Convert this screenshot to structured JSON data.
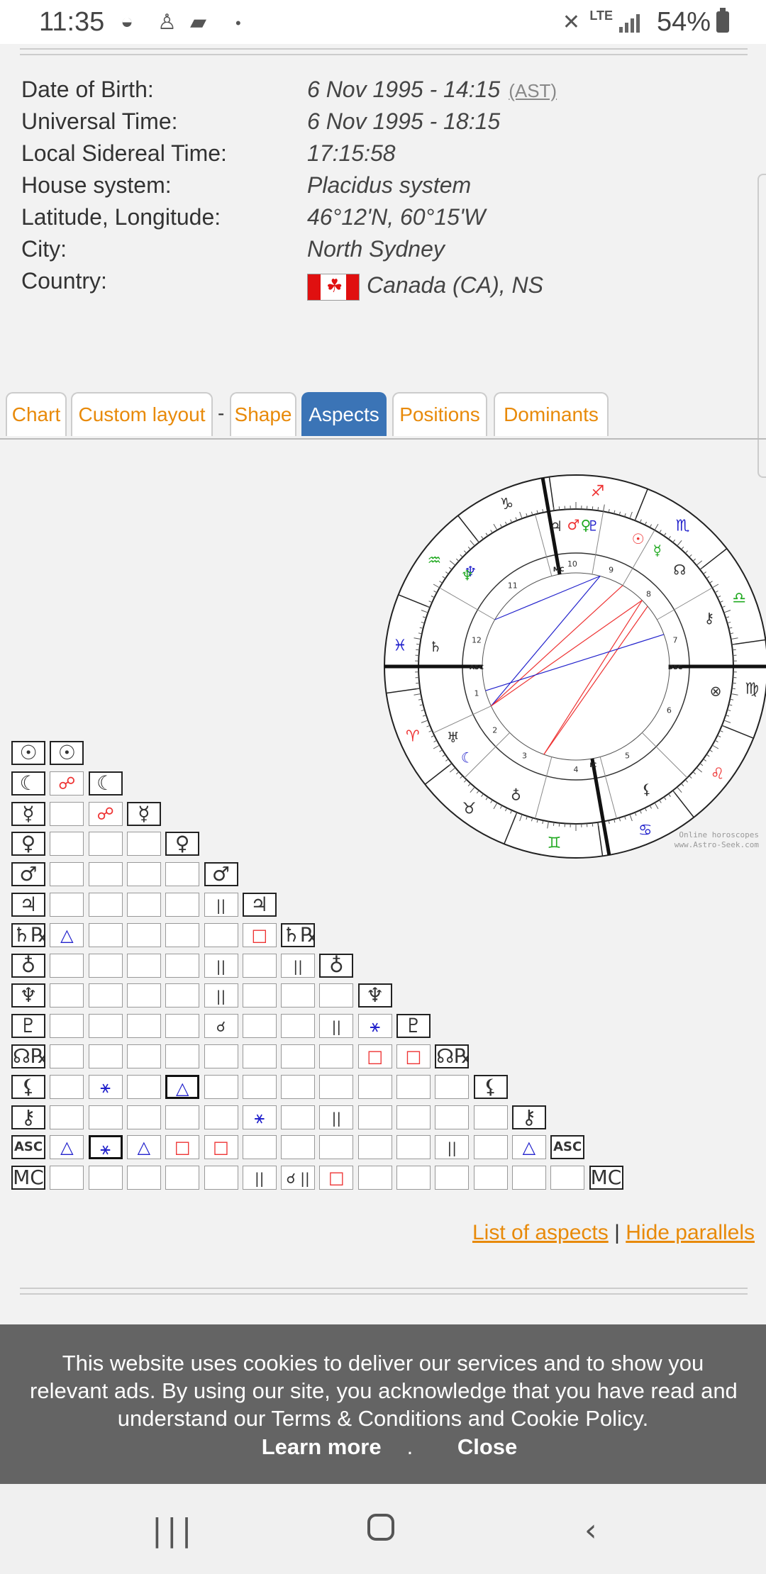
{
  "status_bar": {
    "time": "11:35",
    "network": "LTE",
    "battery": "54%"
  },
  "birth_info": [
    {
      "label": "Date of Birth:",
      "value": "6 Nov 1995 - 14:15",
      "extra": "(AST)"
    },
    {
      "label": "Universal Time:",
      "value": "6 Nov 1995 - 18:15"
    },
    {
      "label": "Local Sidereal Time:",
      "value": "17:15:58"
    },
    {
      "label": "House system:",
      "value": "Placidus system"
    },
    {
      "label": "Latitude, Longitude:",
      "value": "46°12'N, 60°15'W"
    },
    {
      "label": "City:",
      "value": "North Sydney"
    },
    {
      "label": "Country:",
      "value": "Canada (CA), NS"
    }
  ],
  "tabs": [
    "Chart",
    "Custom layout",
    "Shape",
    "Aspects",
    "Positions",
    "Dominants"
  ],
  "tab_separator": "-",
  "active_tab": "Aspects",
  "wheel": {
    "angles": [
      "MC",
      "IC",
      "ASC",
      "DSC"
    ],
    "houses": [
      "1",
      "2",
      "3",
      "4",
      "5",
      "6",
      "7",
      "8",
      "9",
      "10",
      "11",
      "12"
    ],
    "signs": [
      "♑",
      "♐",
      "♏",
      "♎",
      "♍",
      "♌",
      "♋",
      "♊",
      "♉",
      "♈",
      "♓",
      "♒"
    ],
    "watermark_line1": "Online horoscopes",
    "watermark_line2": "www.Astro-Seek.com"
  },
  "aspect_grid": {
    "planets": [
      "☉",
      "☾",
      "☿",
      "♀",
      "♂",
      "♃",
      "♄℞",
      "♁",
      "♆",
      "♇",
      "☊℞",
      "⚸",
      "⚷",
      "ASC",
      "MC"
    ],
    "cells": [
      {
        "r": 1,
        "c": 0,
        "sym": "☍",
        "color": "red"
      },
      {
        "r": 2,
        "c": 1,
        "sym": "☍",
        "color": "red"
      },
      {
        "r": 5,
        "c": 4,
        "sym": "||",
        "color": "black"
      },
      {
        "r": 5,
        "c": 5,
        "sym": "☌ ||",
        "color": "black"
      },
      {
        "r": 6,
        "c": 0,
        "sym": "△",
        "color": "blue"
      },
      {
        "r": 6,
        "c": 5,
        "sym": "□",
        "color": "red"
      },
      {
        "r": 6,
        "c": 6,
        "sym": "□",
        "color": "red"
      },
      {
        "r": 7,
        "c": 4,
        "sym": "||",
        "color": "black"
      },
      {
        "r": 7,
        "c": 6,
        "sym": "||",
        "color": "black"
      },
      {
        "r": 8,
        "c": 4,
        "sym": "||",
        "color": "black"
      },
      {
        "r": 8,
        "c": 8,
        "sym": "☌ ||",
        "color": "black"
      },
      {
        "r": 9,
        "c": 4,
        "sym": "☌",
        "color": "black"
      },
      {
        "r": 9,
        "c": 7,
        "sym": "||",
        "color": "black"
      },
      {
        "r": 9,
        "c": 8,
        "sym": "⚹",
        "color": "blue"
      },
      {
        "r": 10,
        "c": 8,
        "sym": "□",
        "color": "red"
      },
      {
        "r": 10,
        "c": 9,
        "sym": "□",
        "color": "red"
      },
      {
        "r": 11,
        "c": 1,
        "sym": "⚹",
        "color": "blue"
      },
      {
        "r": 11,
        "c": 3,
        "sym": "△",
        "color": "blue",
        "bold": true
      },
      {
        "r": 12,
        "c": 5,
        "sym": "⚹",
        "color": "blue"
      },
      {
        "r": 12,
        "c": 7,
        "sym": "||",
        "color": "black"
      },
      {
        "r": 12,
        "c": 12,
        "sym": "□",
        "color": "red"
      },
      {
        "r": 13,
        "c": 0,
        "sym": "△",
        "color": "blue"
      },
      {
        "r": 13,
        "c": 1,
        "sym": "⚹",
        "color": "blue",
        "bold": true
      },
      {
        "r": 13,
        "c": 2,
        "sym": "△",
        "color": "blue"
      },
      {
        "r": 13,
        "c": 3,
        "sym": "□",
        "color": "red"
      },
      {
        "r": 13,
        "c": 4,
        "sym": "□",
        "color": "red"
      },
      {
        "r": 13,
        "c": 10,
        "sym": "||",
        "color": "black"
      },
      {
        "r": 13,
        "c": 12,
        "sym": "△",
        "color": "blue"
      },
      {
        "r": 14,
        "c": 5,
        "sym": "||",
        "color": "black"
      },
      {
        "r": 14,
        "c": 6,
        "sym": "☌ ||",
        "color": "black"
      },
      {
        "r": 14,
        "c": 7,
        "sym": "□",
        "color": "red"
      }
    ]
  },
  "links": {
    "list_of_aspects": "List of aspects",
    "separator": "|",
    "hide_parallels": "Hide parallels"
  },
  "cookie_banner": {
    "line1": "This website uses cookies to deliver our services and to show you",
    "line2": "relevant ads. By using our site, you acknowledge that you have read and",
    "line3": "understand our Terms & Conditions and Cookie Policy.",
    "learn_more": "Learn more",
    "learn_more_suffix": ".",
    "close": "Close"
  },
  "colors": {
    "accent": "#e88a0a",
    "active_tab": "#3b74b6",
    "aspect_red": "#e33333",
    "aspect_blue": "#2222cc"
  }
}
